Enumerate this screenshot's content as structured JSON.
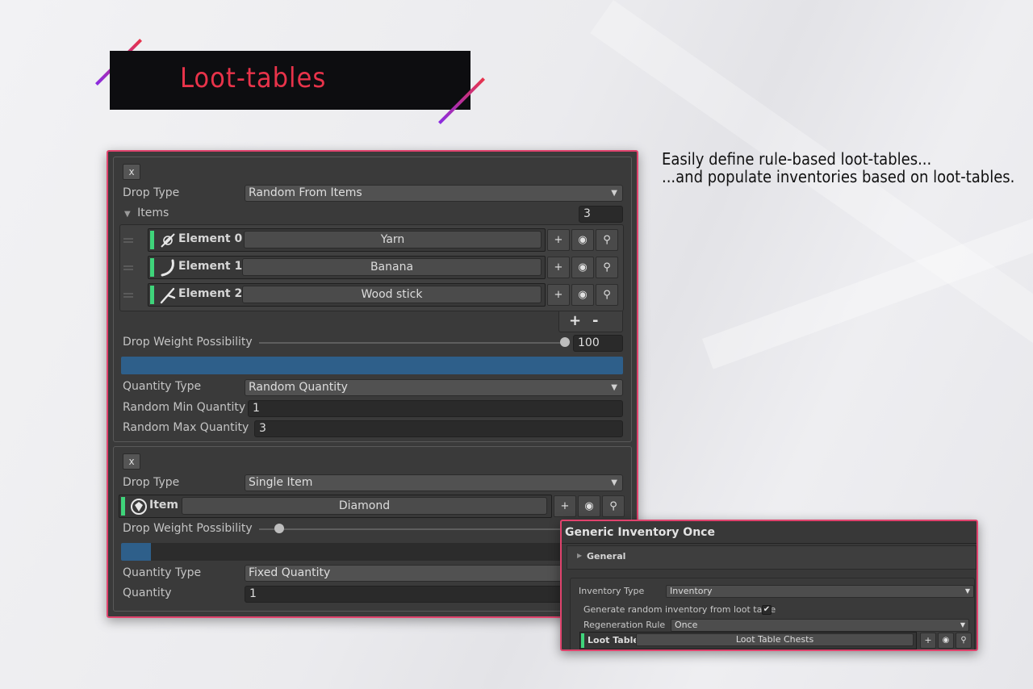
{
  "banner": {
    "title": "Loot-tables"
  },
  "description": {
    "line1": "Easily define rule-based loot-tables...",
    "line2": "...and populate inventories based on loot-tables."
  },
  "colors": {
    "accent": "#e8334a",
    "panel_border": "#e0436d",
    "green_marker": "#3fd47a",
    "progress_fill": "#2e5f8a"
  },
  "loot_entries": [
    {
      "remove_label": "x",
      "drop_type_label": "Drop Type",
      "drop_type_value": "Random From Items",
      "items_label": "Items",
      "items_count": "3",
      "elements": [
        {
          "label": "Element 0",
          "value": "Yarn",
          "icon": "yarn-icon"
        },
        {
          "label": "Element 1",
          "value": "Banana",
          "icon": "banana-icon"
        },
        {
          "label": "Element 2",
          "value": "Wood stick",
          "icon": "wood-stick-icon"
        }
      ],
      "list_add": "+",
      "list_remove": "-",
      "weight_label": "Drop Weight Possibility",
      "weight_value": "100",
      "weight_fraction": 1.0,
      "quantity_type_label": "Quantity Type",
      "quantity_type_value": "Random Quantity",
      "min_label": "Random Min Quantity",
      "min_value": "1",
      "max_label": "Random Max Quantity",
      "max_value": "3"
    },
    {
      "remove_label": "x",
      "drop_type_label": "Drop Type",
      "drop_type_value": "Single Item",
      "item_label": "Item",
      "item_value": "Diamond",
      "item_icon": "diamond-icon",
      "weight_label": "Drop Weight Possibility",
      "weight_fraction": 0.06,
      "quantity_type_label": "Quantity Type",
      "quantity_type_value": "Fixed Quantity",
      "quantity_label": "Quantity",
      "quantity_value": "1"
    }
  ],
  "buttons": {
    "add": "+",
    "arrow": "▼"
  },
  "inventory_panel": {
    "title": "Generic Inventory Once",
    "general_label": "General",
    "inventory_type_label": "Inventory Type",
    "inventory_type_value": "Inventory",
    "generate_label": "Generate random inventory from loot table",
    "generate_checked": true,
    "regen_label": "Regeneration Rule",
    "regen_value": "Once",
    "loot_table_label": "Loot Table",
    "loot_table_value": "Loot Table Chests"
  }
}
